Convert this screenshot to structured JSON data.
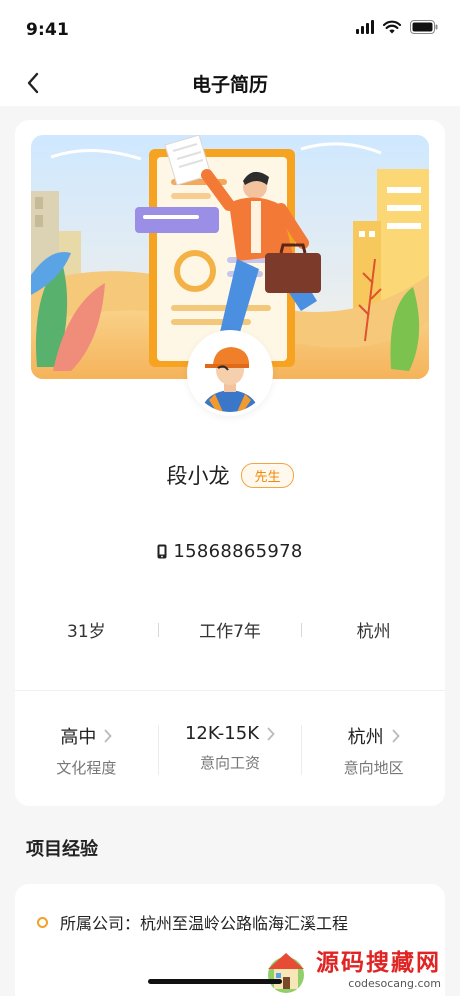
{
  "status_bar": {
    "time": "9:41"
  },
  "nav": {
    "title": "电子简历"
  },
  "profile": {
    "name": "段小龙",
    "gender_badge": "先生",
    "phone": "15868865978",
    "age": "31岁",
    "experience": "工作7年",
    "city": "杭州"
  },
  "intents": [
    {
      "value": "高中",
      "label": "文化程度"
    },
    {
      "value": "12K-15K",
      "label": "意向工资"
    },
    {
      "value": "杭州",
      "label": "意向地区"
    }
  ],
  "project_section": {
    "title": "项目经验",
    "items": [
      {
        "text": "所属公司：杭州至温岭公路临海汇溪工程"
      }
    ]
  },
  "watermark": {
    "title": "源码搜藏网",
    "subtitle": "codesocang.com"
  },
  "colors": {
    "accent": "#f08a0c",
    "background": "#f6f6f6",
    "card": "#ffffff"
  }
}
